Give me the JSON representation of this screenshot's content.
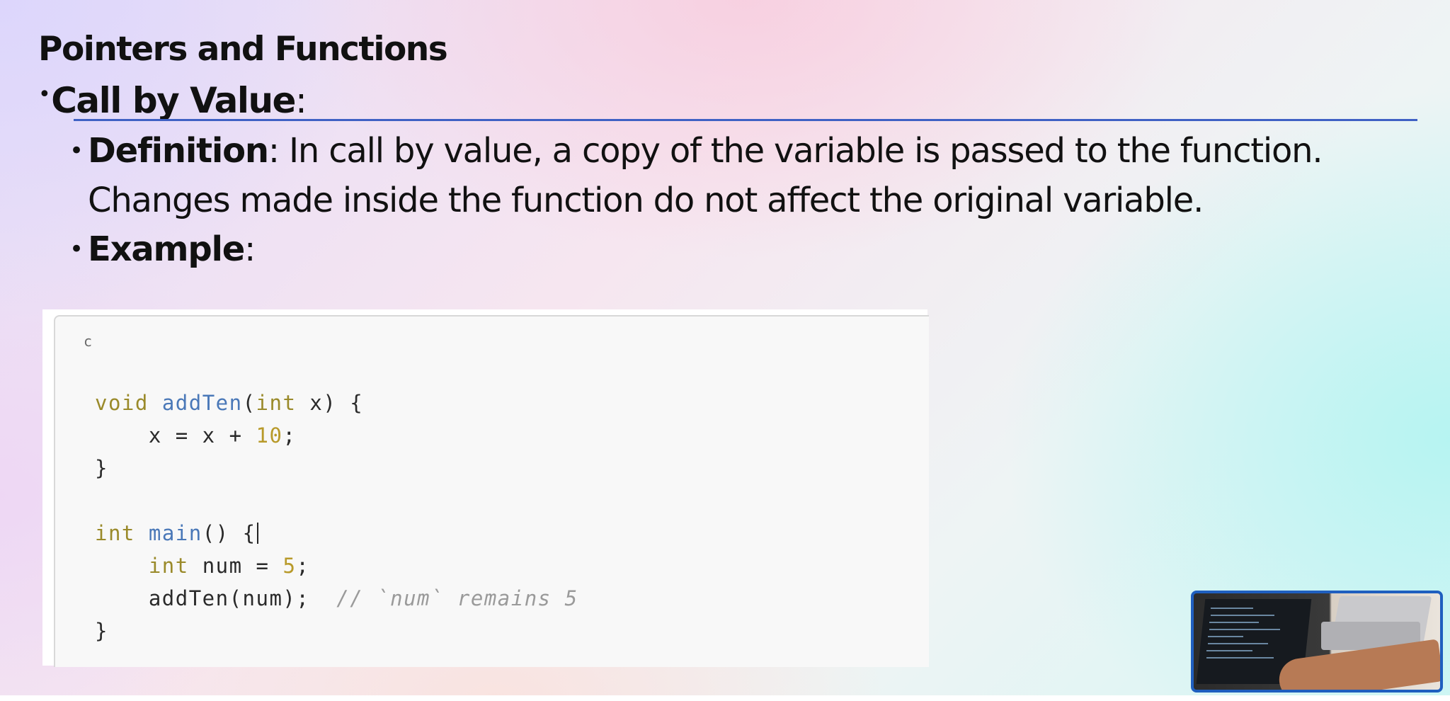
{
  "slide": {
    "title": "Pointers and Functions",
    "bullet": {
      "label": "Call by Value",
      "colon": ":"
    },
    "definition": {
      "label": "Definition",
      "text": ": In call by value, a copy of the variable is passed to the function. Changes made inside the function do not affect the original variable."
    },
    "example": {
      "label": "Example",
      "colon": ":"
    },
    "code": {
      "language": "c",
      "lines": [
        "void addTen(int x) {",
        "    x = x + 10;",
        "}",
        "",
        "int main() {",
        "    int num = 5;",
        "    addTen(num);  // `num` remains 5",
        "}"
      ]
    },
    "thumbnail": {
      "icon": "laptop-photo"
    }
  },
  "colors": {
    "rule": "#3f61c4",
    "thumbnail_border": "#1f5fbf",
    "keyword": "#9a8a2a",
    "function_name": "#4a78b8",
    "number": "#b89a2a",
    "comment": "#9a9a9a"
  }
}
